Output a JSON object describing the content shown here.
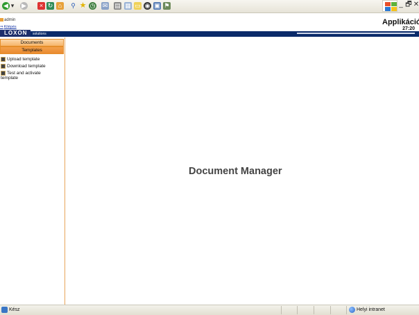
{
  "browser": {
    "toolbar_icons": [
      "back-icon",
      "forward-icon",
      "stop-icon",
      "refresh-icon",
      "home-icon",
      "search-icon",
      "favorites-icon",
      "history-icon",
      "mail-icon",
      "print-icon",
      "edit-icon",
      "discuss-icon",
      "research-icon",
      "messenger-icon"
    ],
    "window_controls": [
      "_",
      "🗗",
      "✕"
    ]
  },
  "app": {
    "user": "admin",
    "logout": "Kilépés",
    "title": "Applikáció",
    "timer": "27:20",
    "logo_text": "LOXON",
    "logo_sub": "solutions"
  },
  "sidebar": {
    "buttons": [
      {
        "label": "Documents"
      },
      {
        "label": "Templates"
      }
    ],
    "items": [
      {
        "label": "Upload template"
      },
      {
        "label": "Download template"
      },
      {
        "label": "Test and activate template"
      }
    ]
  },
  "main": {
    "title": "Document Manager"
  },
  "status": {
    "text": "Kész",
    "zone": "Helyi intranet"
  },
  "colors": {
    "accent": "#f3a04a",
    "header_bar": "#0b2b6a"
  }
}
